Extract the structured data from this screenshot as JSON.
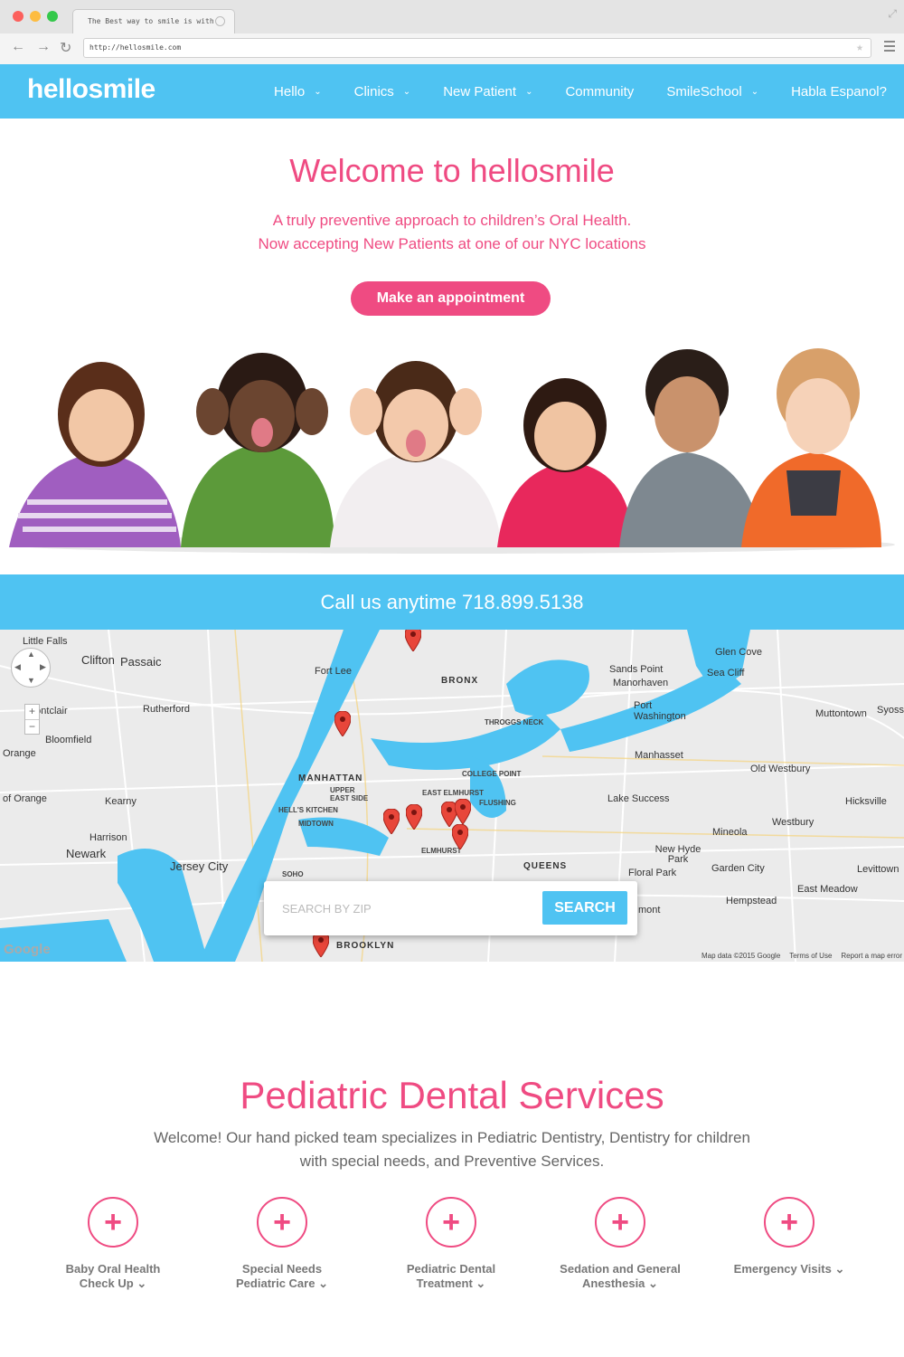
{
  "browser": {
    "tab_title": "The Best way to smile is with",
    "url": "http://hellosmile.com"
  },
  "header": {
    "logo": "hellosmile",
    "nav": [
      {
        "label": "Hello",
        "dropdown": true
      },
      {
        "label": "Clinics",
        "dropdown": true
      },
      {
        "label": "New Patient",
        "dropdown": true
      },
      {
        "label": "Community",
        "dropdown": false
      },
      {
        "label": "SmileSchool",
        "dropdown": true
      },
      {
        "label": "Habla Espanol?",
        "dropdown": false
      }
    ]
  },
  "hero": {
    "title": "Welcome to hellosmile",
    "tagline_1": "A truly preventive approach to children’s Oral Health.",
    "tagline_2": "Now accepting New Patients at one of our NYC locations",
    "cta": "Make an appointment"
  },
  "callbar": {
    "text": "Call us anytime 718.899.5138"
  },
  "map": {
    "labels": [
      "Little Falls",
      "Clifton",
      "Passaic",
      "Montclair",
      "Bloomfield",
      "Orange",
      "of Orange",
      "Rutherford",
      "Kearny",
      "Harrison",
      "Newark",
      "Jersey City",
      "Fort Lee",
      "BRONX",
      "MANHATTAN",
      "UPPER EAST SIDE",
      "HELL'S KITCHEN",
      "MIDTOWN",
      "SOHO",
      "THROGGS NECK",
      "COLLEGE POINT",
      "EAST ELMHURST",
      "FLUSHING",
      "ELMHURST",
      "QUEENS",
      "BROOKLYN",
      "Glen Cove",
      "Sea Cliff",
      "Sands Point",
      "Manorhaven",
      "Port Washington",
      "Manhasset",
      "Muttontown",
      "Syoss",
      "Old Westbury",
      "Lake Success",
      "Hicksville",
      "Westbury",
      "Mineola",
      "New Hyde Park",
      "Garden City",
      "Floral Park",
      "Levittown",
      "East Meadow",
      "Hempstead",
      "mont"
    ],
    "search_placeholder": "SEARCH BY ZIP",
    "search_button": "SEARCH",
    "footer": [
      "Map data ©2015 Google",
      "Terms of Use",
      "Report a map error"
    ],
    "google": "Google",
    "zoom_in": "+",
    "zoom_out": "−"
  },
  "services": {
    "title": "Pediatric Dental Services",
    "intro": "Welcome! Our hand picked team specializes in Pediatric Dentistry, Dentistry for children with special needs, and Preventive Services.",
    "items": [
      {
        "line1": "Baby Oral Health",
        "line2": "Check Up"
      },
      {
        "line1": "Special Needs",
        "line2": "Pediatric Care"
      },
      {
        "line1": "Pediatric Dental",
        "line2": "Treatment"
      },
      {
        "line1": "Sedation and General",
        "line2": "Anesthesia"
      },
      {
        "line1": "Emergency Visits",
        "line2": ""
      }
    ]
  },
  "colors": {
    "blue": "#4fc3f2",
    "pink": "#ef4b82",
    "water": "#4fc3f2"
  }
}
